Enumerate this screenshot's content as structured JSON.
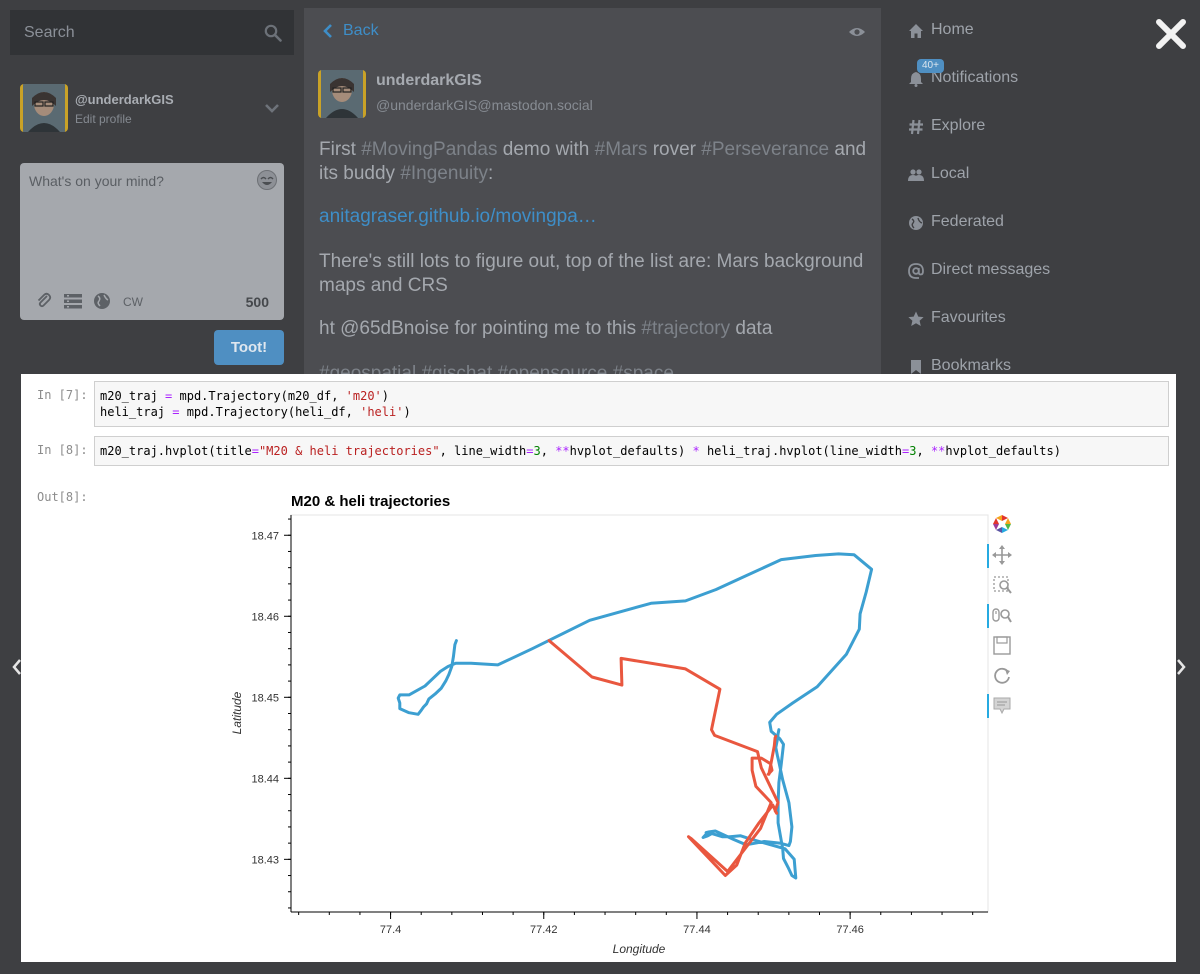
{
  "search": {
    "placeholder": "Search"
  },
  "account": {
    "name": "@underdarkGIS",
    "edit_label": "Edit profile"
  },
  "composer": {
    "placeholder": "What's on your mind?",
    "cw_label": "CW",
    "char_count": "500",
    "submit_label": "Toot!"
  },
  "status": {
    "back_label": "Back",
    "display_name": "underdarkGIS",
    "handle": "@underdarkGIS@mastodon.social",
    "p1": {
      "t1": "First ",
      "h1": "#MovingPandas",
      "t2": " demo with ",
      "h2": "#Mars",
      "t3": " rover ",
      "h3": "#Perseverance",
      "t4": " and its buddy ",
      "h4": "#Ingenuity",
      "t5": ":"
    },
    "link": "anitagraser.github.io/movingpa…",
    "p2": "There's still lots to figure out, top of the list are: Mars background maps and CRS",
    "p3": {
      "t1": "ht @65dBnoise for pointing me to this ",
      "h1": "#trajectory",
      "t2": " data"
    },
    "p4": "#geospatial #gischat #opensource #space"
  },
  "nav": {
    "items": [
      {
        "label": "Home",
        "icon": "home-icon"
      },
      {
        "label": "Notifications",
        "icon": "bell-icon"
      },
      {
        "label": "Explore",
        "icon": "hash-icon"
      },
      {
        "label": "Local",
        "icon": "users-icon"
      },
      {
        "label": "Federated",
        "icon": "globe-icon"
      },
      {
        "label": "Direct messages",
        "icon": "at-icon"
      },
      {
        "label": "Favourites",
        "icon": "star-icon"
      },
      {
        "label": "Bookmarks",
        "icon": "bookmark-icon"
      }
    ],
    "notifications_badge": "40+"
  },
  "notebook": {
    "cell1_prompt": "In [7]:",
    "cell1_line1": {
      "a": "m20_traj ",
      "eq": "=",
      "b": " mpd.Trajectory(m20_df, ",
      "s": "'m20'",
      "c": ")"
    },
    "cell1_line2": {
      "a": "heli_traj ",
      "eq": "=",
      "b": " mpd.Trajectory(heli_df, ",
      "s": "'heli'",
      "c": ")"
    },
    "cell2_prompt": "In [8]:",
    "cell2": {
      "a": "m20_traj.hvplot(title",
      "eq1": "=",
      "s1": "\"M20 & heli trajectories\"",
      "b": ", line_width",
      "eq2": "=",
      "n1": "3",
      "c": ", ",
      "op1": "**",
      "d": "hvplot_defaults) ",
      "op2": "*",
      "e": " heli_traj.hvplot(line_width",
      "eq3": "=",
      "n2": "3",
      "f": ", ",
      "op3": "**",
      "g": "hvplot_defaults)"
    },
    "out_prompt": "Out[8]:"
  },
  "chart_data": {
    "type": "line",
    "title": "M20 & heli trajectories",
    "xlabel": "Longitude",
    "ylabel": "Latitude",
    "xlim": [
      77.387,
      77.478
    ],
    "ylim": [
      18.4235,
      18.4725
    ],
    "xticks": [
      77.4,
      77.42,
      77.44,
      77.46
    ],
    "yticks": [
      18.43,
      18.44,
      18.45,
      18.46,
      18.47
    ],
    "grid": false,
    "series": [
      {
        "color": "#3c9fd1",
        "x": [
          77.4086,
          77.4084,
          77.4082,
          77.408,
          77.4076,
          77.4072,
          77.4066,
          77.4058,
          77.405,
          77.4047,
          77.4043,
          77.404,
          77.4036,
          77.4024,
          77.4012,
          77.4012,
          77.401,
          77.4012,
          77.4024,
          77.4045,
          77.4055,
          77.4065,
          77.4075,
          77.4085,
          77.4105,
          77.414,
          77.4185,
          77.426,
          77.434,
          77.4385,
          77.4425,
          77.4464,
          77.451,
          77.4555,
          77.4585,
          77.4605,
          77.4628,
          77.4621,
          77.4613,
          77.4612,
          77.4595,
          77.4557,
          77.4525,
          77.4504,
          77.4495,
          77.4497,
          77.4508,
          77.4513,
          77.451,
          77.4507,
          77.4506,
          77.4506,
          77.4512,
          77.4513,
          77.4519,
          77.4524,
          77.4529,
          77.4527,
          77.4515,
          77.447,
          77.4457,
          77.4443,
          77.4433,
          77.4419,
          77.4412,
          77.4408,
          77.4414,
          77.4418,
          77.4412,
          77.4416,
          77.4424,
          77.4447,
          77.4464,
          77.4488,
          77.4508,
          77.452,
          77.4522,
          77.4524,
          77.452,
          77.4512,
          77.4507,
          77.4505,
          77.4503,
          77.4505,
          77.4506,
          77.4507
        ],
        "y": [
          18.457,
          18.4565,
          18.455,
          18.4538,
          18.4528,
          18.452,
          18.4511,
          18.4504,
          18.4498,
          18.4492,
          18.4488,
          18.4484,
          18.4479,
          18.4481,
          18.4486,
          18.4493,
          18.4499,
          18.4503,
          18.4503,
          18.4514,
          18.4523,
          18.4532,
          18.4538,
          18.4542,
          18.4542,
          18.454,
          18.456,
          18.4595,
          18.4616,
          18.4619,
          18.4633,
          18.465,
          18.467,
          18.4675,
          18.4677,
          18.4676,
          18.4658,
          18.463,
          18.4603,
          18.4584,
          18.4553,
          18.4513,
          18.4493,
          18.4479,
          18.4469,
          18.4458,
          18.4449,
          18.4442,
          18.4417,
          18.4395,
          18.437,
          18.4345,
          18.4313,
          18.4301,
          18.429,
          18.428,
          18.4277,
          18.43,
          18.4313,
          18.4325,
          18.4329,
          18.4328,
          18.4328,
          18.4332,
          18.4331,
          18.4327,
          18.4329,
          18.4331,
          18.4333,
          18.4334,
          18.4335,
          18.4325,
          18.4318,
          18.4322,
          18.432,
          18.4317,
          18.4322,
          18.434,
          18.437,
          18.4398,
          18.442,
          18.4428,
          18.4438,
          18.4448,
          18.4455,
          18.446
        ]
      },
      {
        "color": "#e9573f",
        "x": [
          77.4207,
          77.4263,
          77.4302,
          77.4301,
          77.4385,
          77.443,
          77.4419,
          77.4423,
          77.4479,
          77.4484,
          77.4506,
          77.4502,
          77.4504,
          77.4499,
          77.4481,
          77.4463,
          77.4452,
          77.4437,
          77.4389,
          77.4392,
          77.444,
          77.4483,
          77.4497,
          77.4477,
          77.4472,
          77.4472,
          77.4476,
          77.4484,
          77.4496,
          77.4498,
          77.4493,
          77.4494,
          77.4498,
          77.4501,
          77.4502,
          77.4503
        ],
        "y": [
          18.457,
          18.4525,
          18.4515,
          18.4548,
          18.4535,
          18.451,
          18.446,
          18.4453,
          18.4433,
          18.4413,
          18.437,
          18.436,
          18.4357,
          18.4367,
          18.4345,
          18.432,
          18.4293,
          18.428,
          18.4328,
          18.4326,
          18.4285,
          18.4338,
          18.437,
          18.439,
          18.441,
          18.4425,
          18.4425,
          18.4425,
          18.4418,
          18.441,
          18.4405,
          18.4405,
          18.4425,
          18.444,
          18.445,
          18.4452
        ]
      }
    ]
  }
}
